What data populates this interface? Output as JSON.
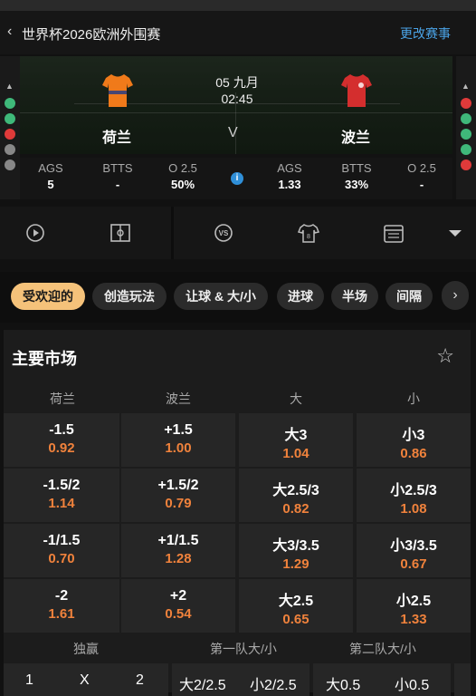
{
  "header": {
    "back_icon": "chevron-left-icon",
    "title": "世界杯2026欧洲外围赛",
    "change_link": "更改赛事"
  },
  "match": {
    "home_team": "荷兰",
    "away_team": "波兰",
    "date": "05 九月",
    "time": "02:45",
    "vs": "V",
    "home_kit_color": "#f07a1a",
    "away_kit_color": "#d42e2e",
    "left_form": [
      "#3fb87a",
      "#3fb87a",
      "#e03a3a",
      "#888888",
      "#888888"
    ],
    "right_form": [
      "#e03a3a",
      "#3fb87a",
      "#3fb87a",
      "#3fb87a",
      "#e03a3a"
    ]
  },
  "stats": {
    "home": [
      {
        "label": "AGS",
        "value": "5"
      },
      {
        "label": "BTTS",
        "value": "-"
      },
      {
        "label": "O 2.5",
        "value": "50%"
      }
    ],
    "away": [
      {
        "label": "AGS",
        "value": "1.33"
      },
      {
        "label": "BTTS",
        "value": "33%"
      },
      {
        "label": "O 2.5",
        "value": "-"
      }
    ],
    "info_icon": "info-icon"
  },
  "iconbar": {
    "icons": [
      "play-icon",
      "pitch-icon",
      "vs-icon",
      "jersey-icon",
      "calendar-icon",
      "dropdown-icon"
    ]
  },
  "chips": {
    "items": [
      "受欢迎的",
      "创造玩法",
      "让球 & 大/小",
      "进球",
      "半场",
      "间隔"
    ],
    "active": "受欢迎的"
  },
  "market": {
    "title": "主要市场",
    "columns": [
      "荷兰",
      "波兰",
      "大",
      "小"
    ],
    "rows": [
      {
        "home": {
          "line": "-1.5",
          "odds": "0.92"
        },
        "away": {
          "line": "+1.5",
          "odds": "1.00"
        },
        "over": {
          "line": "大3",
          "odds": "1.04"
        },
        "under": {
          "line": "小3",
          "odds": "0.86"
        }
      },
      {
        "home": {
          "line": "-1.5/2",
          "odds": "1.14"
        },
        "away": {
          "line": "+1.5/2",
          "odds": "0.79"
        },
        "over": {
          "line": "大2.5/3",
          "odds": "0.82"
        },
        "under": {
          "line": "小2.5/3",
          "odds": "1.08"
        }
      },
      {
        "home": {
          "line": "-1/1.5",
          "odds": "0.70"
        },
        "away": {
          "line": "+1/1.5",
          "odds": "1.28"
        },
        "over": {
          "line": "大3/3.5",
          "odds": "1.29"
        },
        "under": {
          "line": "小3/3.5",
          "odds": "0.67"
        }
      },
      {
        "home": {
          "line": "-2",
          "odds": "1.61"
        },
        "away": {
          "line": "+2",
          "odds": "0.54"
        },
        "over": {
          "line": "大2.5",
          "odds": "0.65"
        },
        "under": {
          "line": "小2.5",
          "odds": "1.33"
        }
      }
    ],
    "sub_headers": [
      "独赢",
      "第一队大/小",
      "第二队大/小"
    ],
    "bottom": {
      "winner": [
        "1",
        "X",
        "2"
      ],
      "team1": [
        "大2/2.5",
        "小2/2.5"
      ],
      "team2": [
        "大0.5",
        "小0.5"
      ]
    }
  }
}
